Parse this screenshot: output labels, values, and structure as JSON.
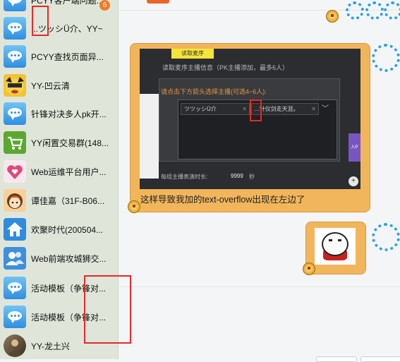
{
  "contacts": [
    {
      "name": "PCYY客户端问题...",
      "avatar": "bubble-icon",
      "badge": "6"
    },
    {
      "name": "...ツッシÜ介、YY~",
      "avatar": "bubble-icon"
    },
    {
      "name": "PCYY查找页面异...",
      "avatar": "bubble-icon"
    },
    {
      "name": "YY-凹云清",
      "avatar": "cartoon-face-icon"
    },
    {
      "name": "针锋对决多人pk开...",
      "avatar": "bubble-icon"
    },
    {
      "name": "YY闲置交易群(148...",
      "avatar": "cart-icon"
    },
    {
      "name": "Web运维平台用户...",
      "avatar": "heart-icon"
    },
    {
      "name": "谭佳嘉（31F-B06...",
      "avatar": "girl-avatar-icon"
    },
    {
      "name": "欢聚时代(200504...",
      "avatar": "home-icon"
    },
    {
      "name": "Web前端攻城狮交...",
      "avatar": "people-icon"
    },
    {
      "name": "活动模板（争锋对...",
      "avatar": "bubble-icon"
    },
    {
      "name": "活动模板（争锋对...",
      "avatar": "bubble-icon"
    },
    {
      "name": "YY-龙土兴",
      "avatar": "photo-avatar-icon"
    }
  ],
  "message": {
    "screenshot": {
      "button": "读取麦序",
      "hint1": "读取麦序主播信息（PK主播添加，最多6人）",
      "hint2": "请点击下方箭头选择主播(可选4~6人):",
      "tags": [
        "ツツッシÜ介",
        "...针仪剑走天涯。"
      ],
      "footer_label": "每组主播表演时长:",
      "footer_value": "9999",
      "footer_unit": "秒",
      "side_text": "入P"
    },
    "text": "这样导致我加的text-overflow出现在左边了"
  },
  "colors": {
    "sidebar_bg": "#dfe6d9",
    "bubble_bg": "#f1b65b",
    "accent": "#e8662a",
    "annotation_red": "#e52a2a"
  }
}
